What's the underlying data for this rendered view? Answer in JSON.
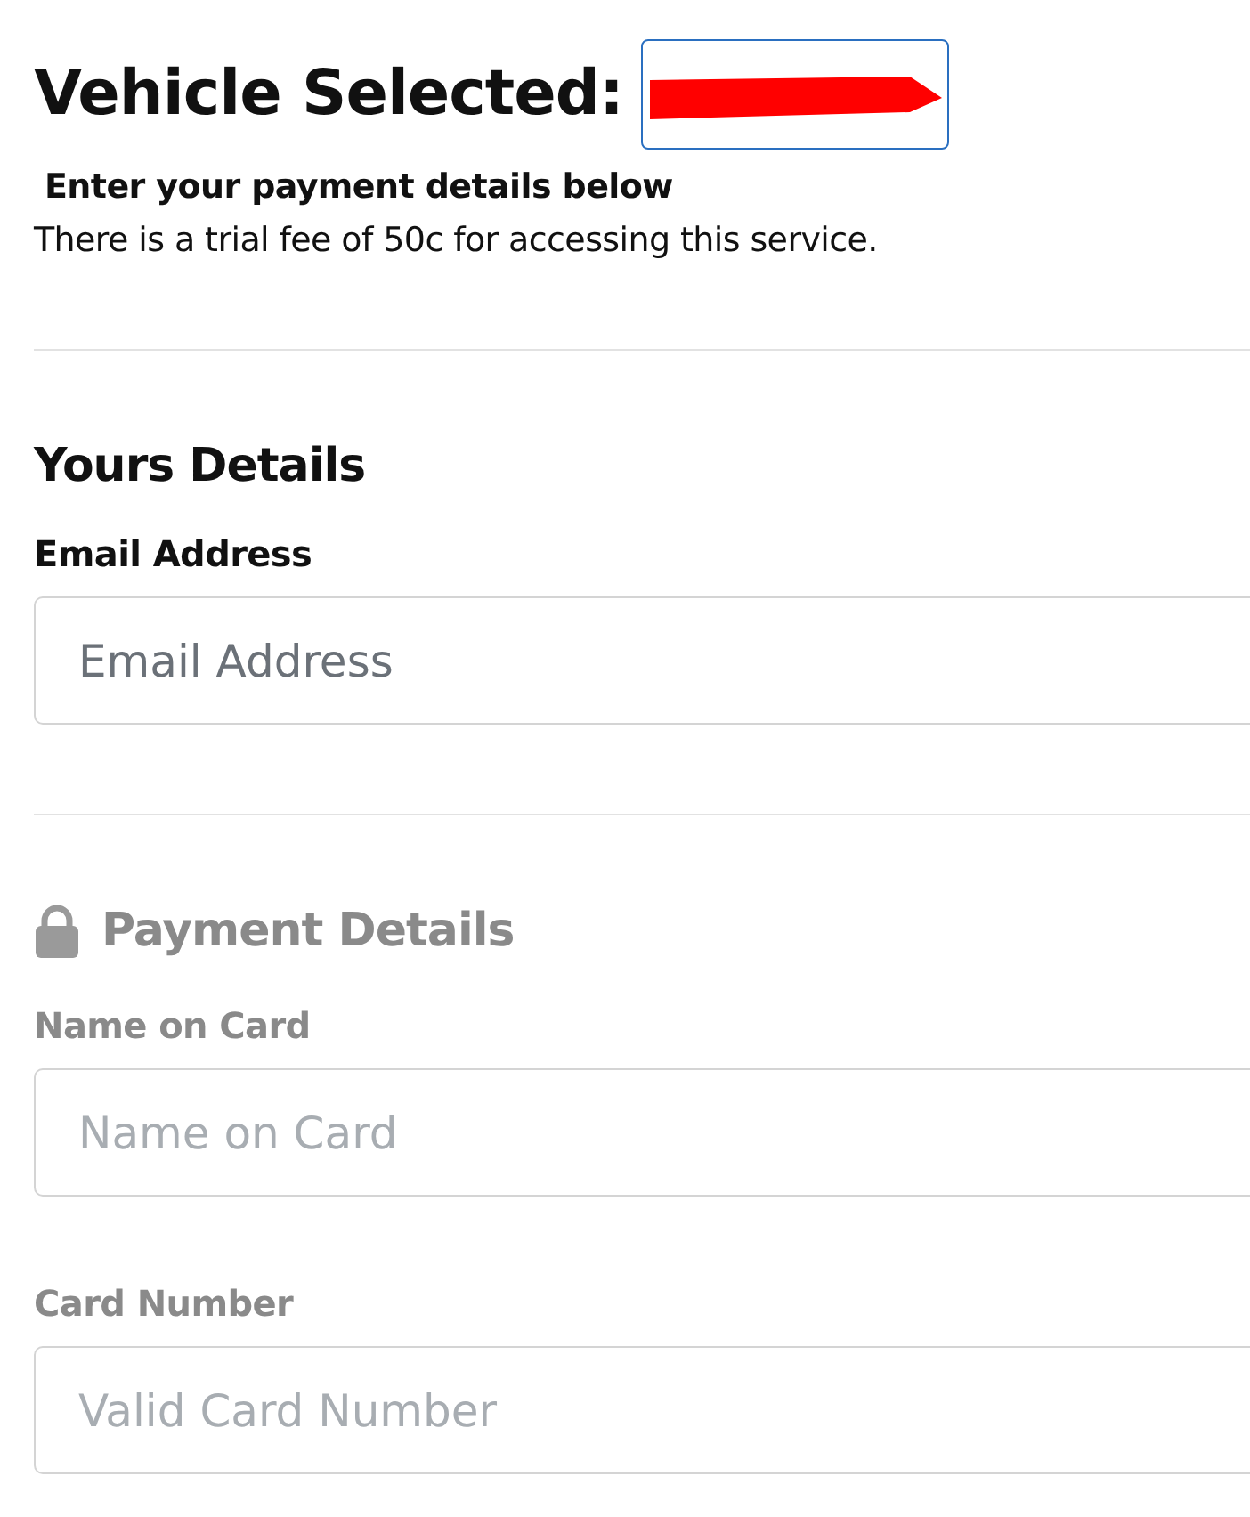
{
  "header": {
    "title": "Vehicle Selected:",
    "vehicle": {
      "redacted": true
    }
  },
  "intro": {
    "heading": "Enter your payment details below",
    "note": "There is a trial fee of 50c for accessing this service."
  },
  "details": {
    "heading": "Yours Details",
    "fields": [
      {
        "label": "Email Address",
        "placeholder": "Email Address"
      }
    ]
  },
  "payment": {
    "heading": "Payment Details",
    "disabled": true,
    "fields": [
      {
        "label": "Name on Card",
        "placeholder": "Name on Card"
      },
      {
        "label": "Card Number",
        "placeholder": "Valid Card Number"
      }
    ]
  }
}
